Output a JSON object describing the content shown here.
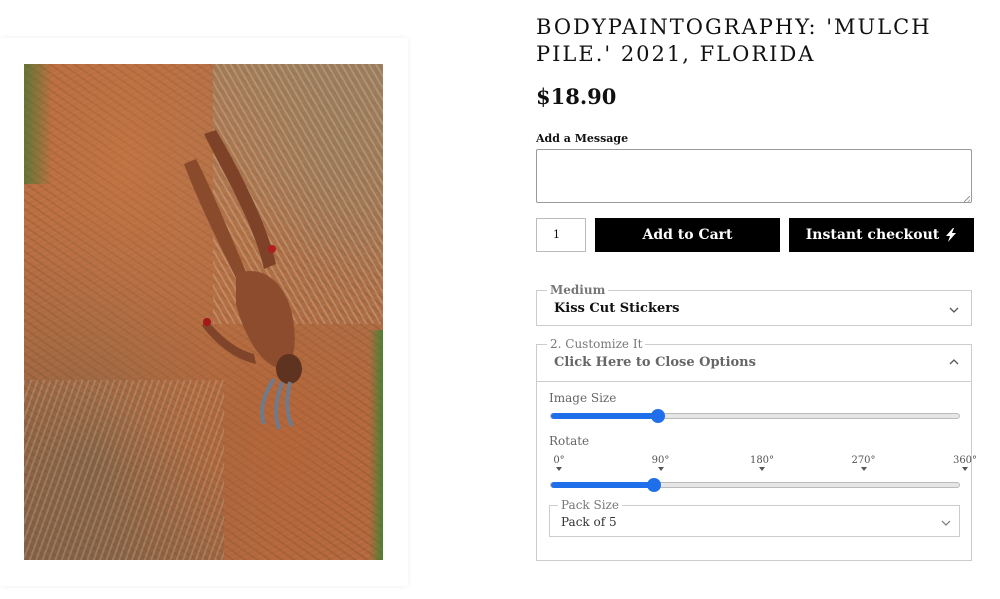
{
  "product": {
    "title": "BODYPAINTOGRAPHY: 'MULCH PILE.' 2021, FLORIDA",
    "price": "$18.90",
    "image_icon": "product-photo"
  },
  "message": {
    "label": "Add a Message",
    "value": "",
    "placeholder": ""
  },
  "purchase": {
    "quantity": "1",
    "add_to_cart_label": "Add to Cart",
    "instant_checkout_label": "Instant checkout",
    "instant_checkout_icon": "lightning-bolt-icon",
    "button_color": "#000000"
  },
  "medium": {
    "legend": "Medium",
    "selected": "Kiss Cut Stickers"
  },
  "customize": {
    "legend": "2. Customize It",
    "toggle_label": "Click Here to Close Options",
    "image_size": {
      "label": "Image Size",
      "level_fraction": 0.26
    },
    "rotate": {
      "label": "Rotate",
      "ticks": [
        "0°",
        "90°",
        "180°",
        "270°",
        "360°"
      ],
      "value_degrees": 90
    },
    "pack_size": {
      "legend": "Pack Size",
      "selected": "Pack of 5"
    },
    "slider_color": "#1f6feb"
  }
}
